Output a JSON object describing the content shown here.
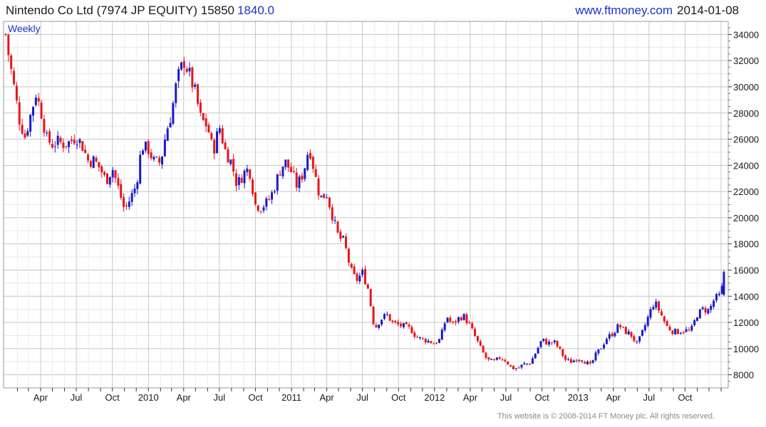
{
  "header": {
    "security": "Nintendo Co Ltd (7974 JP EQUITY)",
    "last_price": "15850",
    "change": "1840.0",
    "site": "www.ftmoney.com",
    "date": "2014-01-08"
  },
  "footer": {
    "copyright": "This website is © 2008-2014 FT Money plc. All rights reserved."
  },
  "colors": {
    "up": "#1a1acc",
    "down": "#e8151b",
    "grid": "#c8c8c8",
    "frame": "#999999",
    "label": "#1a1a1a",
    "period_label": "#1a33cc"
  },
  "chart_data": {
    "type": "candlestick",
    "period_label": "Weekly",
    "ylim": [
      7000,
      35000
    ],
    "y_ticks": [
      8000,
      10000,
      12000,
      14000,
      16000,
      18000,
      20000,
      22000,
      24000,
      26000,
      28000,
      30000,
      32000,
      34000
    ],
    "x_range": [
      "2009-01-02",
      "2014-01-10"
    ],
    "x_ticks": [
      {
        "label": "Apr",
        "date": "2009-04-01"
      },
      {
        "label": "Jul",
        "date": "2009-07-01"
      },
      {
        "label": "Oct",
        "date": "2009-10-01"
      },
      {
        "label": "2010",
        "date": "2010-01-01"
      },
      {
        "label": "Apr",
        "date": "2010-04-01"
      },
      {
        "label": "Jul",
        "date": "2010-07-01"
      },
      {
        "label": "Oct",
        "date": "2010-10-01"
      },
      {
        "label": "2011",
        "date": "2011-01-01"
      },
      {
        "label": "Apr",
        "date": "2011-04-01"
      },
      {
        "label": "Jul",
        "date": "2011-07-01"
      },
      {
        "label": "Oct",
        "date": "2011-10-01"
      },
      {
        "label": "2012",
        "date": "2012-01-01"
      },
      {
        "label": "Apr",
        "date": "2012-04-01"
      },
      {
        "label": "Jul",
        "date": "2012-07-01"
      },
      {
        "label": "Oct",
        "date": "2012-10-01"
      },
      {
        "label": "2013",
        "date": "2013-01-01"
      },
      {
        "label": "Apr",
        "date": "2013-04-01"
      },
      {
        "label": "Jul",
        "date": "2013-07-01"
      },
      {
        "label": "Oct",
        "date": "2013-10-01"
      }
    ],
    "grid": true,
    "up_color": "#1a1acc",
    "down_color": "#e8151b",
    "trend": [
      [
        "2009-01-02",
        34000
      ],
      [
        "2009-01-09",
        32500
      ],
      [
        "2009-01-23",
        30000
      ],
      [
        "2009-02-06",
        27500
      ],
      [
        "2009-02-20",
        26200
      ],
      [
        "2009-03-06",
        27800
      ],
      [
        "2009-03-20",
        29500
      ],
      [
        "2009-04-03",
        28000
      ],
      [
        "2009-04-17",
        26000
      ],
      [
        "2009-05-01",
        25600
      ],
      [
        "2009-05-15",
        25800
      ],
      [
        "2009-06-01",
        25600
      ],
      [
        "2009-06-15",
        25800
      ],
      [
        "2009-07-01",
        26200
      ],
      [
        "2009-07-15",
        25600
      ],
      [
        "2009-08-01",
        24300
      ],
      [
        "2009-08-15",
        24400
      ],
      [
        "2009-09-01",
        23700
      ],
      [
        "2009-09-15",
        22800
      ],
      [
        "2009-10-01",
        23800
      ],
      [
        "2009-10-15",
        22400
      ],
      [
        "2009-11-01",
        20600
      ],
      [
        "2009-11-15",
        21400
      ],
      [
        "2009-12-01",
        22500
      ],
      [
        "2009-12-15",
        25500
      ],
      [
        "2010-01-01",
        25200
      ],
      [
        "2010-01-15",
        24300
      ],
      [
        "2010-02-01",
        24200
      ],
      [
        "2010-02-15",
        26500
      ],
      [
        "2010-03-01",
        28000
      ],
      [
        "2010-03-15",
        30500
      ],
      [
        "2010-04-01",
        32000
      ],
      [
        "2010-04-15",
        31000
      ],
      [
        "2010-05-01",
        29500
      ],
      [
        "2010-05-15",
        27500
      ],
      [
        "2010-06-01",
        27000
      ],
      [
        "2010-06-15",
        25000
      ],
      [
        "2010-07-01",
        27000
      ],
      [
        "2010-07-15",
        25200
      ],
      [
        "2010-08-01",
        24200
      ],
      [
        "2010-08-15",
        22500
      ],
      [
        "2010-09-01",
        23400
      ],
      [
        "2010-09-15",
        23800
      ],
      [
        "2010-10-01",
        21000
      ],
      [
        "2010-10-15",
        20800
      ],
      [
        "2010-11-01",
        21200
      ],
      [
        "2010-11-15",
        22000
      ],
      [
        "2010-12-01",
        23500
      ],
      [
        "2010-12-15",
        24300
      ],
      [
        "2011-01-01",
        23500
      ],
      [
        "2011-01-15",
        22400
      ],
      [
        "2011-02-01",
        23500
      ],
      [
        "2011-02-15",
        25500
      ],
      [
        "2011-03-01",
        23400
      ],
      [
        "2011-03-15",
        21500
      ],
      [
        "2011-04-01",
        21800
      ],
      [
        "2011-04-15",
        20200
      ],
      [
        "2011-05-01",
        18500
      ],
      [
        "2011-05-15",
        18200
      ],
      [
        "2011-06-01",
        16000
      ],
      [
        "2011-06-15",
        15200
      ],
      [
        "2011-07-01",
        15800
      ],
      [
        "2011-07-15",
        14600
      ],
      [
        "2011-08-01",
        11500
      ],
      [
        "2011-08-15",
        12200
      ],
      [
        "2011-09-01",
        12600
      ],
      [
        "2011-09-15",
        12000
      ],
      [
        "2011-10-01",
        11800
      ],
      [
        "2011-10-15",
        11700
      ],
      [
        "2011-11-01",
        11500
      ],
      [
        "2011-11-15",
        10900
      ],
      [
        "2011-12-01",
        10700
      ],
      [
        "2011-12-15",
        10600
      ],
      [
        "2012-01-01",
        10400
      ],
      [
        "2012-01-15",
        10700
      ],
      [
        "2012-02-01",
        12500
      ],
      [
        "2012-02-15",
        11800
      ],
      [
        "2012-03-01",
        12300
      ],
      [
        "2012-03-15",
        12500
      ],
      [
        "2012-04-01",
        11700
      ],
      [
        "2012-04-15",
        10800
      ],
      [
        "2012-05-01",
        9800
      ],
      [
        "2012-05-15",
        9100
      ],
      [
        "2012-06-01",
        9000
      ],
      [
        "2012-06-15",
        9300
      ],
      [
        "2012-07-01",
        9100
      ],
      [
        "2012-07-15",
        8500
      ],
      [
        "2012-08-01",
        8500
      ],
      [
        "2012-08-15",
        8800
      ],
      [
        "2012-09-01",
        8900
      ],
      [
        "2012-09-15",
        9700
      ],
      [
        "2012-10-01",
        10700
      ],
      [
        "2012-10-15",
        10400
      ],
      [
        "2012-11-01",
        10500
      ],
      [
        "2012-11-15",
        9900
      ],
      [
        "2012-12-01",
        9100
      ],
      [
        "2012-12-15",
        9000
      ],
      [
        "2013-01-01",
        9300
      ],
      [
        "2013-01-15",
        9100
      ],
      [
        "2013-02-01",
        8700
      ],
      [
        "2013-02-15",
        9500
      ],
      [
        "2013-03-01",
        10100
      ],
      [
        "2013-03-15",
        10800
      ],
      [
        "2013-04-01",
        11200
      ],
      [
        "2013-04-15",
        11800
      ],
      [
        "2013-05-01",
        11300
      ],
      [
        "2013-05-15",
        11100
      ],
      [
        "2013-06-01",
        10300
      ],
      [
        "2013-06-15",
        11300
      ],
      [
        "2013-07-01",
        12600
      ],
      [
        "2013-07-15",
        13600
      ],
      [
        "2013-08-01",
        12600
      ],
      [
        "2013-08-15",
        11700
      ],
      [
        "2013-09-01",
        11300
      ],
      [
        "2013-09-15",
        11300
      ],
      [
        "2013-10-01",
        11400
      ],
      [
        "2013-10-15",
        11300
      ],
      [
        "2013-11-01",
        12600
      ],
      [
        "2013-11-15",
        13000
      ],
      [
        "2013-12-01",
        12900
      ],
      [
        "2013-12-15",
        13800
      ],
      [
        "2014-01-01",
        14100
      ],
      [
        "2014-01-08",
        15850
      ]
    ]
  }
}
